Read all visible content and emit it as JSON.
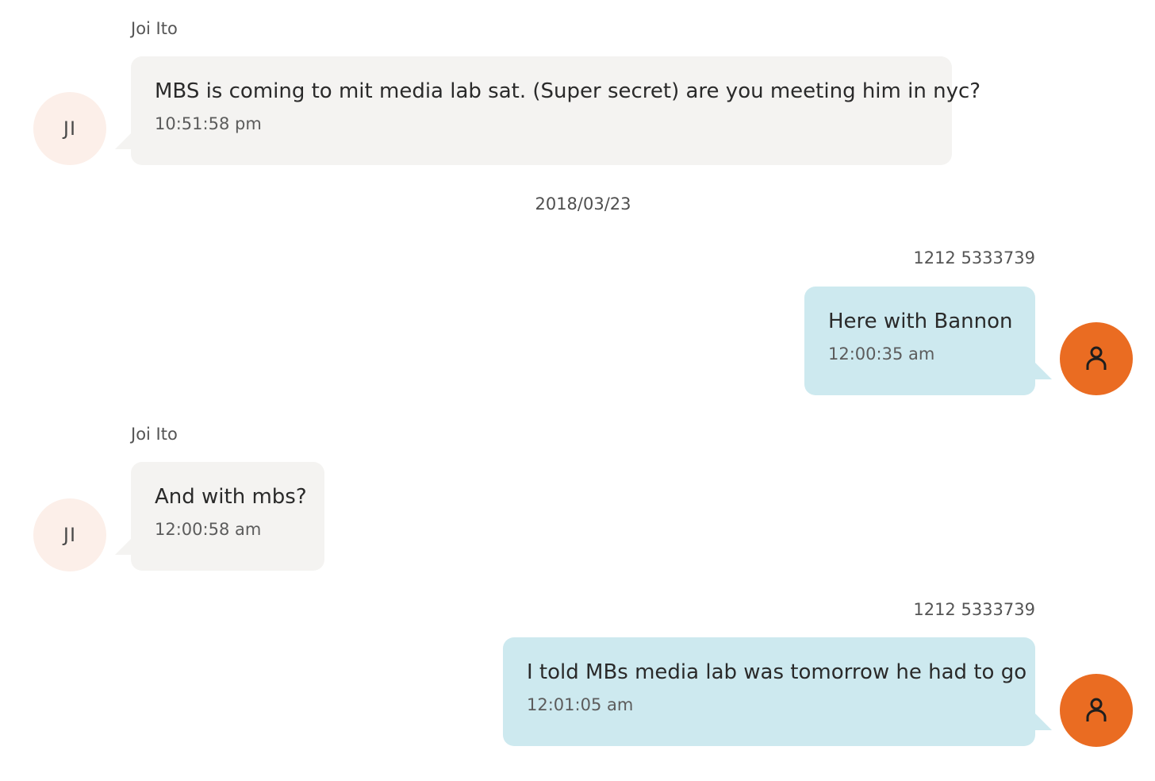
{
  "messages": [
    {
      "sender": "Joi Ito",
      "initials": "JI",
      "text": "MBS is coming to mit media lab sat. (Super secret) are you meeting him in nyc?",
      "time": "10:51:58 pm",
      "direction": "incoming"
    },
    {
      "sender": "1212 5333739",
      "text": "Here with Bannon",
      "time": "12:00:35 am",
      "direction": "outgoing",
      "avatar_icon": "person-icon"
    },
    {
      "sender": "Joi Ito",
      "initials": "JI",
      "text": "And with mbs?",
      "time": "12:00:58 am",
      "direction": "incoming"
    },
    {
      "sender": "1212 5333739",
      "text": "I told MBs  media lab was tomorrow he had to go",
      "time": "12:01:05 am",
      "direction": "outgoing",
      "avatar_icon": "person-icon"
    }
  ],
  "date_separator": "2018/03/23",
  "colors": {
    "incoming_bubble": "#f4f3f1",
    "outgoing_bubble": "#cde9ef",
    "initials_avatar": "#fcefe9",
    "user_avatar": "#ea6c22"
  }
}
